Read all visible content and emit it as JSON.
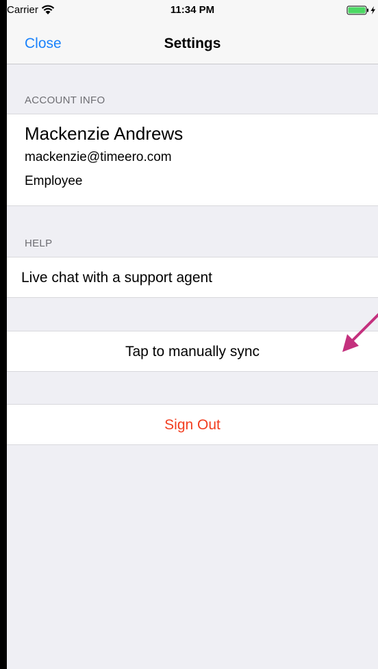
{
  "status_bar": {
    "carrier": "Carrier",
    "time": "11:34 PM",
    "wifi_icon": "wifi-icon",
    "battery_icon": "battery-charging-icon"
  },
  "nav": {
    "close_label": "Close",
    "title": "Settings"
  },
  "account_info": {
    "header": "ACCOUNT INFO",
    "name": "Mackenzie Andrews",
    "email": "mackenzie@timeero.com",
    "role": "Employee"
  },
  "help": {
    "header": "HELP",
    "live_chat_label": "Live chat with a support agent"
  },
  "sync": {
    "label": "Tap to manually sync"
  },
  "sign_out": {
    "label": "Sign Out"
  },
  "colors": {
    "accent": "#1a82fb",
    "destructive": "#f23d1f",
    "annotation_arrow": "#c4317e",
    "background": "#efeff4"
  }
}
